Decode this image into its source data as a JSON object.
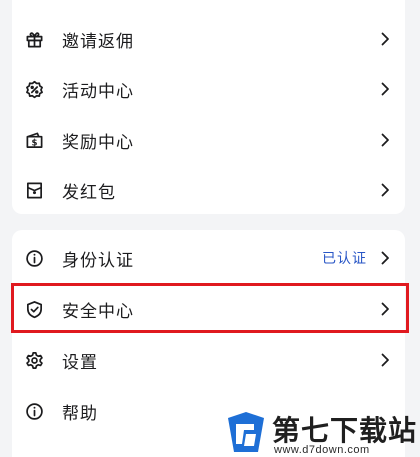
{
  "menu_group_1": {
    "items": [
      {
        "label": "邀请返佣",
        "icon": "gift-icon"
      },
      {
        "label": "活动中心",
        "icon": "badge-percent-icon"
      },
      {
        "label": "奖励中心",
        "icon": "wallet-dollar-icon"
      },
      {
        "label": "发红包",
        "icon": "red-envelope-icon"
      }
    ]
  },
  "menu_group_2": {
    "items": [
      {
        "label": "身份认证",
        "icon": "info-circle-icon",
        "status": "已认证"
      },
      {
        "label": "安全中心",
        "icon": "shield-check-icon",
        "highlighted": true
      },
      {
        "label": "设置",
        "icon": "gear-icon"
      },
      {
        "label": "帮助",
        "icon": "info-circle-icon"
      }
    ]
  },
  "colors": {
    "highlight_border": "#e0191f",
    "status_text": "#2856c6",
    "background": "#f3f4f6"
  },
  "watermark": {
    "title": "第七下载站",
    "url": "www.d7down.com"
  }
}
